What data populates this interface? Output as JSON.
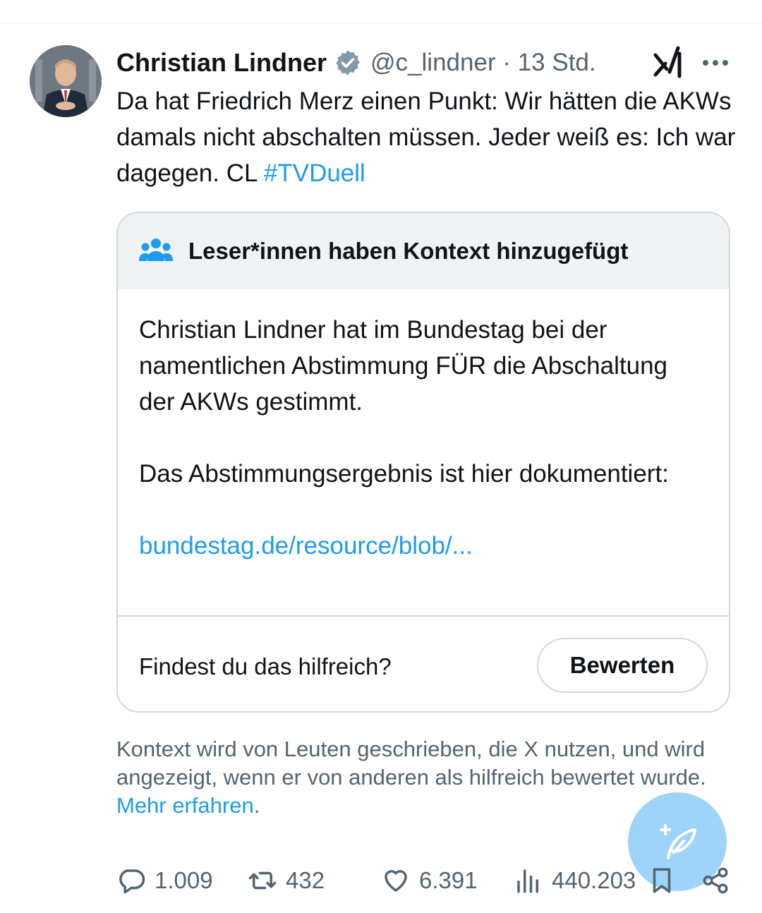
{
  "tweet": {
    "author_name": "Christian Lindner",
    "handle_time": "@c_lindner · 13 Std.",
    "text_main": "Da hat Friedrich Merz einen Punkt: Wir hätten die AKWs damals nicht abschalten müssen. Jeder weiß es: Ich war dagegen. CL ",
    "hashtag": "#TVDuell"
  },
  "note": {
    "title": "Leser*innen haben Kontext hinzugefügt",
    "paragraph1": "Christian Lindner hat im Bundestag bei der namentlichen Abstimmung FÜR die Abschaltung der AKWs gestimmt.",
    "paragraph2": "Das Abstimmungsergebnis ist hier dokumentiert:",
    "link": "bundestag.de/resource/blob/...",
    "helpful_question": "Findest du das hilfreich?",
    "rate_button": "Bewerten"
  },
  "context": {
    "text": "Kontext wird von Leuten geschrieben, die X nutzen, und wird angezeigt, wenn er von anderen als hilfreich bewertet wurde. ",
    "more_link": "Mehr erfahren",
    "period": "."
  },
  "actions": {
    "replies": "1.009",
    "reposts": "432",
    "likes": "6.391",
    "views": "440.203"
  },
  "icons": {
    "verified": "verified-badge-icon",
    "grok": "grok-icon",
    "more": "more-icon",
    "community": "community-notes-icon",
    "compose": "compose-icon",
    "reply": "reply-icon",
    "repost": "repost-icon",
    "like": "like-icon",
    "views": "views-icon",
    "bookmark": "bookmark-icon",
    "share": "share-icon"
  },
  "colors": {
    "accent": "#1d9bf0",
    "text": "#0f1419",
    "muted": "#536471",
    "border": "#cfd9de",
    "note_header_bg": "#f0f2f3"
  }
}
